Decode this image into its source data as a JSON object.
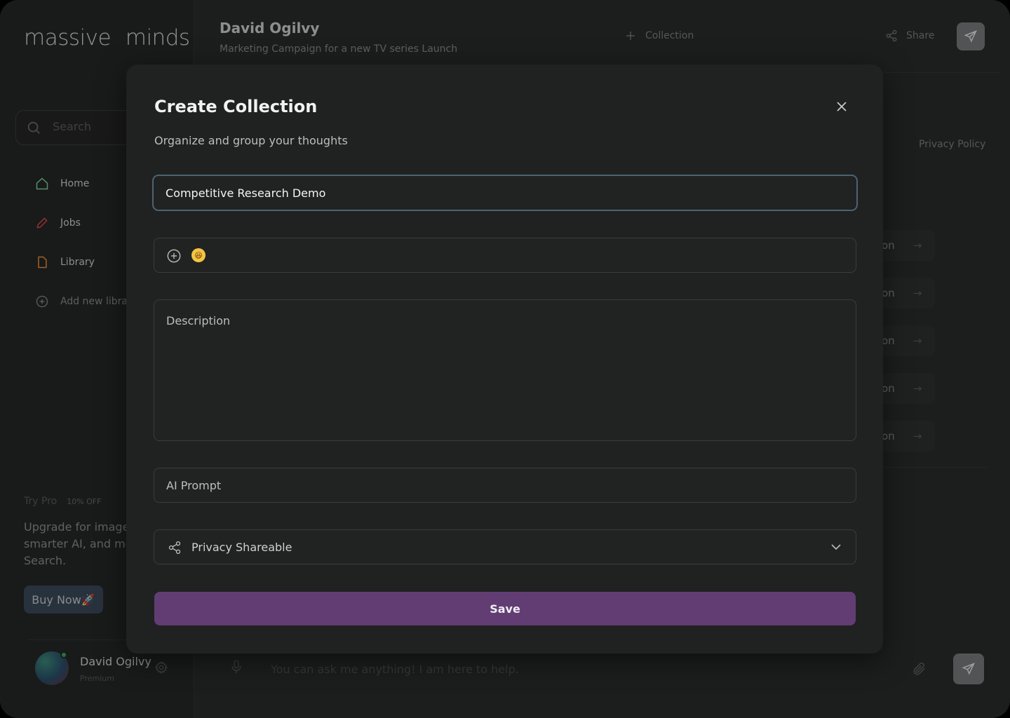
{
  "brand": {
    "logo_part1": "massive",
    "logo_part2": "minds"
  },
  "sidebar": {
    "search_placeholder": "Search",
    "items": [
      {
        "label": "Home",
        "icon": "home-icon"
      },
      {
        "label": "Jobs",
        "icon": "pencil-icon"
      },
      {
        "label": "Library",
        "icon": "file-icon"
      },
      {
        "label": "Add new libra",
        "icon": "plus-circle-icon"
      }
    ],
    "promo": {
      "title": "Try Pro",
      "badge": "10% OFF",
      "text": "Upgrade for image smarter AI, and mo Search.",
      "button": "Buy Now🚀"
    },
    "user": {
      "name": "David Ogilvy",
      "status": "Premium"
    }
  },
  "header": {
    "title": "David Ogilvy",
    "subtitle": "Marketing Campaign for a new TV series Launch",
    "collection_label": "Collection",
    "share_label": "Share"
  },
  "background": {
    "privacy_link": "Privacy Policy",
    "pills": [
      "on",
      "on",
      "on",
      "on",
      "on"
    ],
    "chat_placeholder": "You can ask me anything! I am here to help."
  },
  "modal": {
    "title": "Create Collection",
    "subtitle": "Organize and group your thoughts",
    "name_value": "Competitive Research Demo",
    "emoji": "😆",
    "description_placeholder": "Description",
    "ai_prompt_placeholder": "AI Prompt",
    "privacy_value": "Privacy Shareable",
    "save_label": "Save"
  },
  "colors": {
    "background": "#2a2b2b",
    "modal": "#202121",
    "accent_purple": "#623d73",
    "focus_border": "#4c6470"
  }
}
